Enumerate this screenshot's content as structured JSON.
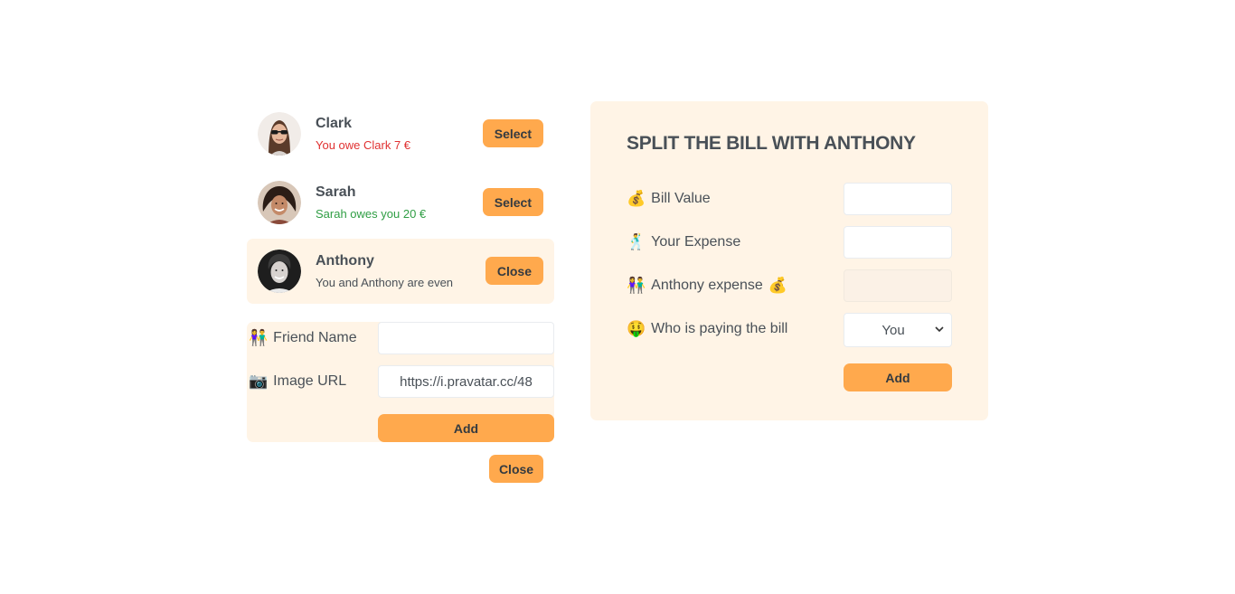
{
  "friends": [
    {
      "name": "Clark",
      "status": "You owe Clark 7 €",
      "button": "Select"
    },
    {
      "name": "Sarah",
      "status": "Sarah owes you 20 €",
      "button": "Select"
    },
    {
      "name": "Anthony",
      "status": "You and Anthony are even",
      "button": "Close"
    }
  ],
  "add_friend": {
    "name_label": "Friend Name",
    "name_icon": "👫",
    "name_value": "",
    "image_label": "Image URL",
    "image_icon": "📷",
    "image_value": "https://i.pravatar.cc/48",
    "add_label": "Add"
  },
  "close_label": "Close",
  "split": {
    "title": "SPLIT THE BILL WITH ANTHONY",
    "bill_icon": "💰",
    "bill_label": "Bill Value",
    "bill_value": "",
    "expense_icon": "🕺",
    "expense_label": "Your Expense",
    "expense_value": "",
    "friend_icon": "👫",
    "friend_label": "Anthony expense",
    "friend_icon_after": "💰",
    "friend_value": "",
    "payer_icon": "🤑",
    "payer_label": "Who is paying the bill",
    "payer_selected": "You",
    "add_label": "Add"
  },
  "colors": {
    "accent": "#ffa94d",
    "panel": "#fff4e6",
    "owe": "#e03131",
    "owed": "#2f9e44"
  }
}
